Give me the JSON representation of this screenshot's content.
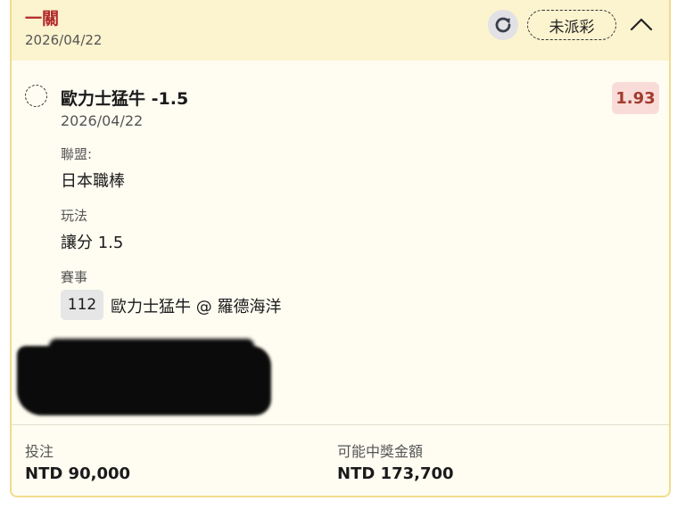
{
  "header": {
    "title": "一關",
    "date": "2026/04/22",
    "status": "未派彩"
  },
  "selection": {
    "title": "歐力士猛牛 -1.5",
    "date": "2026/04/22",
    "odds": "1.93",
    "league_label": "聯盟:",
    "league_value": "日本職棒",
    "market_label": "玩法",
    "market_value": "讓分 1.5",
    "event_label": "賽事",
    "event_number": "112",
    "event_name": "歐力士猛牛 @ 羅德海洋"
  },
  "footer": {
    "stake_label": "投注",
    "stake_value": "NTD 90,000",
    "payout_label": "可能中獎金額",
    "payout_value": "NTD 173,700"
  },
  "colors": {
    "header_bg": "#fcf3cf",
    "card_bg": "#fffdf2",
    "border": "#f0dc8e",
    "title_red": "#b02a2a",
    "odds_bg": "#f9dcd8",
    "odds_text": "#a33a2e"
  },
  "icons": {
    "refresh": "refresh-icon",
    "collapse": "chevron-up-icon",
    "select": "radio-dashed-icon"
  }
}
